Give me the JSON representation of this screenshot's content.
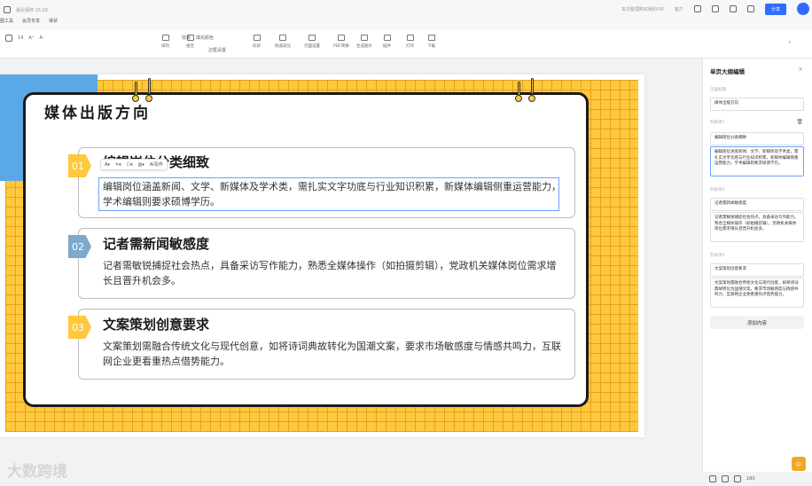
{
  "topbar": {
    "save_status": "最近保存 15:26",
    "vip_text": "本次整理购买我的VIP",
    "username": "客户",
    "share_label": "分享"
  },
  "menu": [
    "图工具",
    "会员专享",
    "得状"
  ],
  "toolbar": {
    "font_size": "14",
    "fill_color": "填充颜色",
    "effect": "效果",
    "outline": "边框设置",
    "labels": {
      "arrange": "排列",
      "align": "组合",
      "shape": "形状",
      "quick": "快速美化",
      "page_setting": "页面设置",
      "pdf": "PDF转换",
      "export_img": "生成图片",
      "plugin": "插件",
      "print": "打印",
      "download": "下载"
    }
  },
  "slide": {
    "title": "媒体出版方向",
    "items": [
      {
        "num": "01",
        "heading": "编辑岗位分类细致",
        "text": "编辑岗位涵盖新闻、文学、新媒体及学术类，需扎实文字功底与行业知识积累，新媒体编辑侧重运营能力，学术编辑则要求硕博学历。"
      },
      {
        "num": "02",
        "heading": "记者需新闻敏感度",
        "text": "记者需敏锐捕捉社会热点，具备采访写作能力，熟悉全媒体操作（如拍摄剪辑），党政机关媒体岗位需求增长且晋升机会多。"
      },
      {
        "num": "03",
        "heading": "文案策划创意要求",
        "text": "文案策划需融合传统文化与现代创意，如将诗词典故转化为国潮文案，要求市场敏感度与情感共鸣力，互联网企业更看重热点借势能力。"
      }
    ],
    "mini_toolbar": {
      "ai_label": "AI写作"
    }
  },
  "panel": {
    "title": "单页大纲编辑",
    "page_title_label": "页面标题",
    "page_title_value": "媒体出版方向",
    "sections": [
      {
        "label": "列表项1",
        "heading": "编辑岗位分类细致",
        "text": "编辑岗位涵盖新闻、文学、新媒体及学术类，需扎实文字功底与行业知识积累，新媒体编辑侧重运营能力，学术编辑则要求硕博学历。"
      },
      {
        "label": "列表项2",
        "heading": "记者需新闻敏感度",
        "text": "记者需敏锐捕捉社会热点，具备采访写作能力，熟悉全媒体操作（如拍摄剪辑），党政机关媒体岗位需求增长且晋升机会多。"
      },
      {
        "label": "列表项3",
        "heading": "文案策划创意要求",
        "text": "文案策划需融合传统文化与现代创意，如将诗词典故转化为国潮文案，要求市场敏感度与情感共鸣力，互联网企业更看重热点借势能力。"
      }
    ],
    "add_button": "添加内容"
  },
  "status": {
    "zoom": "180"
  },
  "watermark": "大数跨境",
  "badge": "中",
  "colors": {
    "accent": "#2f6bff",
    "yellow": "#ffc83d",
    "blue": "#5aa9e6",
    "num1": "#ffc83d",
    "num2": "#7ea8cc",
    "num3": "#ffc83d"
  }
}
